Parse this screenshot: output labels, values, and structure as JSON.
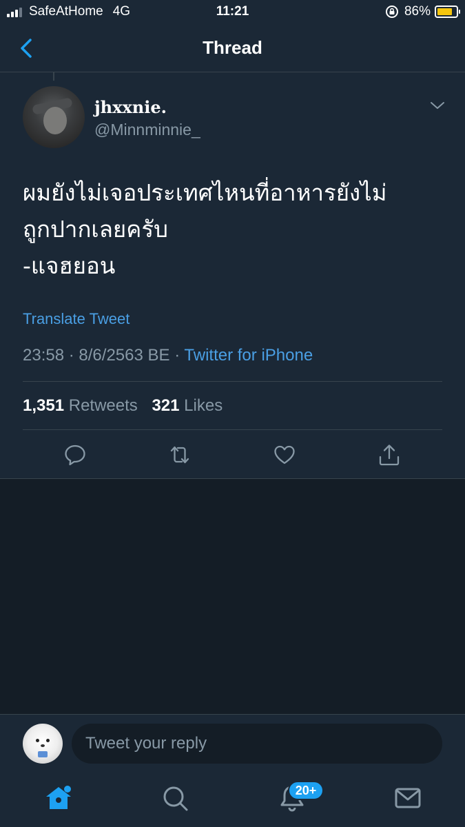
{
  "status_bar": {
    "carrier": "SafeAtHome",
    "network": "4G",
    "time": "11:21",
    "battery": "86%",
    "battery_level": 0.86,
    "signal_bars": 3,
    "battery_color": "#f5c60f"
  },
  "nav": {
    "title": "Thread",
    "back_icon": "chevron-left-icon"
  },
  "tweet": {
    "display_name": "jhxxnie.",
    "handle": "@Minnminnie_",
    "text": "ผมยังไม่เจอประเทศไหนที่อาหารยังไม่\nถูกปากเลยครับ\n-แจฮยอน",
    "translate_label": "Translate Tweet",
    "time": "23:58",
    "date": "8/6/2563 BE",
    "separator": "·",
    "source": "Twitter for iPhone",
    "retweets_count": "1,351",
    "retweets_label": "Retweets",
    "likes_count": "321",
    "likes_label": "Likes",
    "actions": [
      "reply-icon",
      "retweet-icon",
      "like-icon",
      "share-icon"
    ]
  },
  "reply": {
    "placeholder": "Tweet your reply"
  },
  "tabbar": {
    "items": [
      "home-icon",
      "search-icon",
      "notifications-icon",
      "messages-icon"
    ],
    "notifications_badge": "20+",
    "active_color": "#1da1f2"
  },
  "colors": {
    "background": "#141d26",
    "surface": "#1b2836",
    "link": "#4a9fe4",
    "secondary_text": "#8899a6",
    "divider": "#38444d"
  }
}
